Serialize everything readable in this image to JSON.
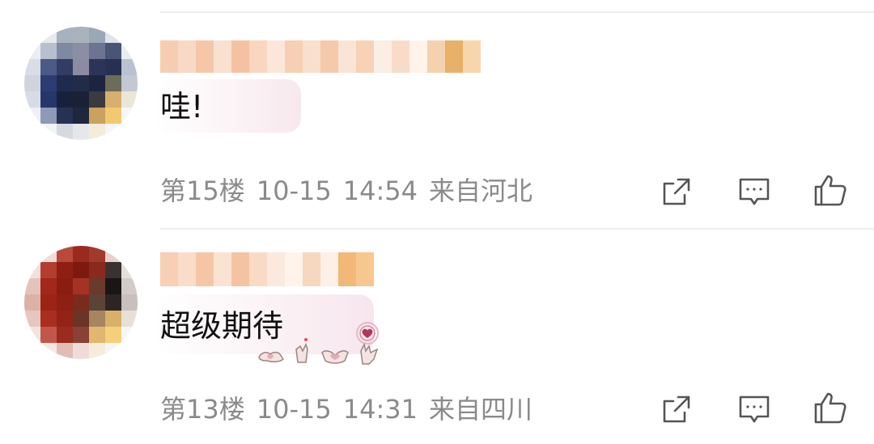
{
  "comments": [
    {
      "username": "",
      "text": "哇!",
      "floor": "第15楼",
      "date": "10-15",
      "time": "14:54",
      "location": "来自河北"
    },
    {
      "username": "",
      "text": "超级期待",
      "floor": "第13楼",
      "date": "10-15",
      "time": "14:31",
      "location": "来自四川"
    }
  ],
  "icons": {
    "share": "share-icon",
    "reply": "comment-icon",
    "like": "thumbs-up-icon",
    "sticker": "heart-hands-sticker"
  },
  "colors": {
    "meta_text": "#8a8a8a",
    "icon_stroke": "#555555",
    "divider": "#ececec",
    "sticker_pink": "#b8325a"
  }
}
